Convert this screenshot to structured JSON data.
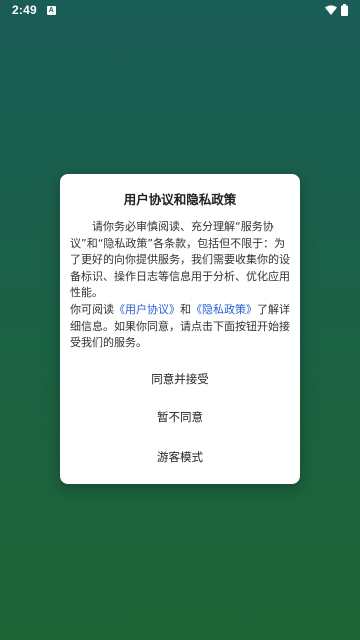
{
  "status_bar": {
    "time": "2:49",
    "notification_glyph": "A",
    "icons": [
      "notification-icon",
      "wifi-icon",
      "battery-icon"
    ]
  },
  "dialog": {
    "title": "用户协议和隐私政策",
    "paragraph1": "请你务必审慎阅读、充分理解“服务协议”和“隐私政策”各条款，包括但不限于：为了更好的向你提供服务，我们需要收集你的设备标识、操作日志等信息用于分析、优化应用性能。",
    "p2_prefix": "你可阅读",
    "link_user_agreement": "《用户协议》",
    "p2_and": "和",
    "link_privacy_policy": "《隐私政策》",
    "p2_suffix": "了解详细信息。如果你同意，请点击下面按钮开始接受我们的服务。",
    "buttons": {
      "agree": "同意并接受",
      "disagree": "暂不同意",
      "guest": "游客模式"
    }
  },
  "colors": {
    "background_top": "#1a5c57",
    "background_bottom": "#1f6436",
    "link": "#2a5fd6",
    "dialog_bg": "#ffffff"
  }
}
